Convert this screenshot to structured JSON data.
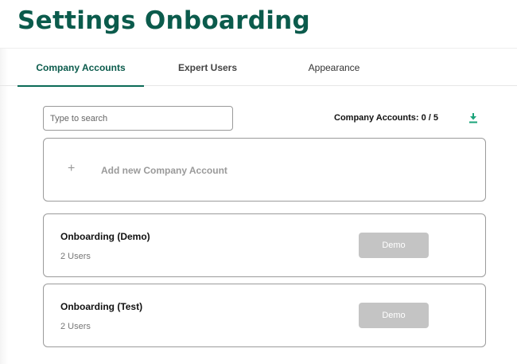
{
  "page_title": "Settings Onboarding",
  "tabs": [
    {
      "label": "Company Accounts",
      "active": true
    },
    {
      "label": "Expert Users",
      "active": false
    },
    {
      "label": "Appearance",
      "active": false
    }
  ],
  "search": {
    "placeholder": "Type to search",
    "value": ""
  },
  "accounts_count": "Company Accounts: 0 / 5",
  "download_icon": "download-icon",
  "add_account": {
    "icon": "plus-icon",
    "label": "Add new Company Account"
  },
  "accounts": [
    {
      "name": "Onboarding (Demo)",
      "users": "2 Users",
      "button_label": "Demo"
    },
    {
      "name": "Onboarding (Test)",
      "users": "2 Users",
      "button_label": "Demo"
    }
  ],
  "colors": {
    "brand": "#0b5b4c",
    "download_icon": "#1aa37a",
    "button_disabled": "#c4c4c4",
    "card_border": "#9b9b9b"
  }
}
